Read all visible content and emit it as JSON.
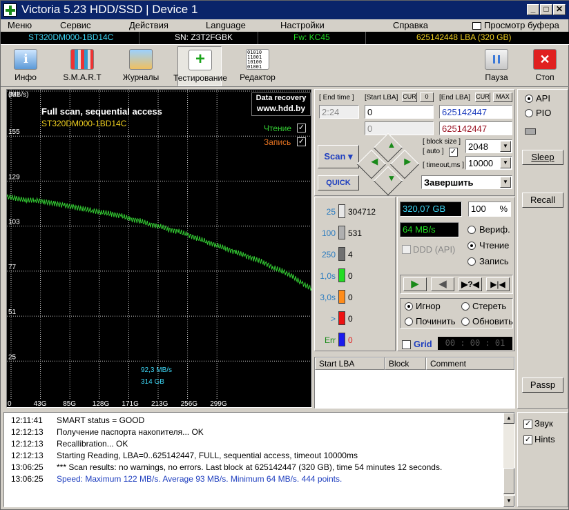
{
  "window": {
    "title": "Victoria 5.23 HDD/SSD  |  Device 1"
  },
  "menu": [
    "Меню",
    "Сервис",
    "Действия",
    "Language",
    "Настройки",
    "Справка",
    "Просмотр буфера"
  ],
  "infobar": {
    "model": "ST320DM000-1BD14C",
    "serial": "SN: Z3T2FGBK",
    "firmware": "Fw: KC45",
    "lba": "625142448 LBA (320 GB)"
  },
  "toolbar": {
    "info": "Инфо",
    "smart": "S.M.A.R.T",
    "logs": "Журналы",
    "test": "Тестирование",
    "editor": "Редактор",
    "pause": "Пауза",
    "stop": "Стоп"
  },
  "chart_data": {
    "type": "line",
    "title": "Full scan, sequential access",
    "subtitle": "ST320DM000-1BD14C",
    "ylabel": "(MB/s)",
    "watermark": [
      "Data recovery",
      "www.hdd.by"
    ],
    "legend": [
      {
        "label": "Чтение",
        "checked": true
      },
      {
        "label": "Запись",
        "checked": true
      }
    ],
    "yticks": [
      "181",
      "155",
      "129",
      "103",
      "77",
      "51",
      "25"
    ],
    "xticks": [
      "0",
      "43G",
      "85G",
      "128G",
      "171G",
      "213G",
      "256G",
      "299G"
    ],
    "ylim": [
      0,
      181
    ],
    "xlim": [
      0,
      320
    ],
    "annotations": [
      "92,3 MB/s",
      "314 GB"
    ],
    "series": [
      {
        "color": "#33cc33",
        "x": [
          0,
          10,
          20,
          30,
          40,
          50,
          60,
          70,
          80,
          90,
          100,
          110,
          120,
          130,
          140,
          150,
          160,
          170,
          180,
          190,
          200,
          210,
          220,
          230,
          240,
          250,
          260,
          270,
          280,
          290,
          300,
          310,
          320
        ],
        "y": [
          120,
          119,
          118,
          118,
          117,
          116,
          115,
          114,
          113,
          112,
          111,
          110,
          109,
          107,
          106,
          104,
          103,
          101,
          100,
          98,
          96,
          94,
          92,
          90,
          88,
          86,
          84,
          82,
          79,
          77,
          74,
          70,
          67
        ]
      }
    ]
  },
  "scan": {
    "end_time_label": "End time",
    "end_time": "2:24",
    "start_lba_label": "Start LBA",
    "cur": "CUR",
    "zero": "0",
    "start_lba": "0",
    "start_lba2": "0",
    "end_lba_label": "End LBA",
    "max": "MAX",
    "end_lba": "625142447",
    "end_lba2": "625142447",
    "block_size_label": "block size",
    "auto_label": "auto",
    "timeout_label": "timeout,ms",
    "block_size": "2048",
    "timeout": "10000",
    "scan_button": "Scan",
    "quick_button": "QUICK",
    "finish_option": "Завершить"
  },
  "stats": {
    "buckets": [
      {
        "label": "25",
        "value": "304712",
        "color": "#e8e8e8"
      },
      {
        "label": "100",
        "value": "531",
        "color": "#b0b0b0"
      },
      {
        "label": "250",
        "value": "4",
        "color": "#707070"
      },
      {
        "label": "1,0s",
        "value": "0",
        "color": "#22dd22"
      },
      {
        "label": "3,0s",
        "value": "0",
        "color": "#ff8c1a"
      },
      {
        "label": ">",
        "value": "0",
        "color": "#ee1111"
      },
      {
        "label": "Err",
        "value": "0",
        "color": "#1a1aee"
      }
    ],
    "position": "320,07 GB",
    "percent": "100",
    "percent_unit": "%",
    "speed": "64 MB/s",
    "ddd": "DDD (API)",
    "verify": "Вериф.",
    "read": "Чтение",
    "write": "Запись",
    "ignore": "Игнор",
    "erase": "Стереть",
    "repair": "Починить",
    "refresh": "Обновить",
    "grid": "Grid",
    "timer": "00 : 00 : 01",
    "table_headers": [
      "Start LBA",
      "Block",
      "Comment"
    ]
  },
  "side": {
    "api": "API",
    "pio": "PIO",
    "sleep": "Sleep",
    "recall": "Recall",
    "passp": "Passp",
    "sound": "Звук",
    "hints": "Hints"
  },
  "log": [
    {
      "time": "12:11:41",
      "text": "SMART status = GOOD",
      "color": "#000000"
    },
    {
      "time": "12:12:13",
      "text": "Получение паспорта накопителя... OK",
      "color": "#000000"
    },
    {
      "time": "12:12:13",
      "text": "Recallibration... OK",
      "color": "#000000"
    },
    {
      "time": "12:12:13",
      "text": "Starting Reading, LBA=0..625142447, FULL, sequential access, timeout 10000ms",
      "color": "#000000"
    },
    {
      "time": "13:06:25",
      "text": "*** Scan results: no warnings, no errors. Last block at 625142447 (320 GB), time 54 minutes 12 seconds.",
      "color": "#000000"
    },
    {
      "time": "13:06:25",
      "text": "Speed: Maximum 122 MB/s. Average 93 MB/s. Minimum 64 MB/s. 444 points.",
      "color": "#1f3fbf"
    }
  ]
}
